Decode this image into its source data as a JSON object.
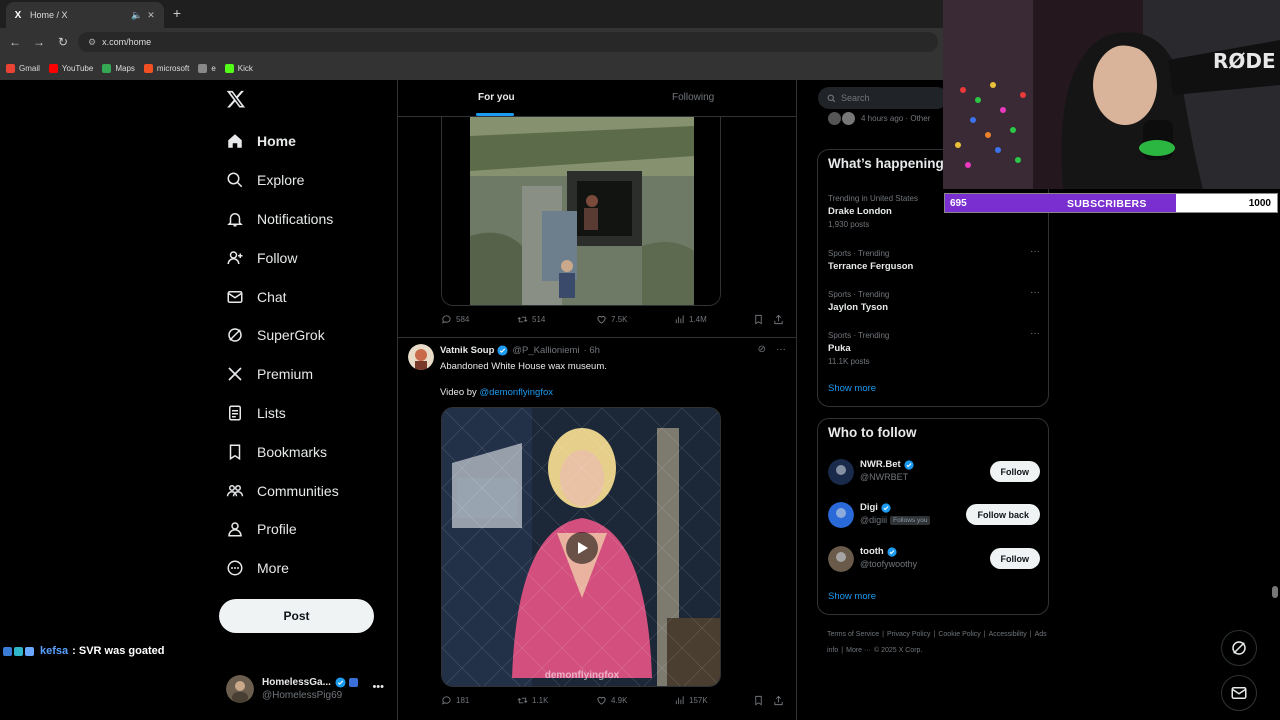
{
  "browser": {
    "tab_title": "Home / X",
    "tab_favicon": "X",
    "url": "x.com/home",
    "bookmarks": [
      {
        "label": "Gmail",
        "color": "#ea4335"
      },
      {
        "label": "YouTube",
        "color": "#ff0000"
      },
      {
        "label": "Maps",
        "color": "#34a853"
      },
      {
        "label": "microsoft",
        "color": "#f25022"
      },
      {
        "label": "e",
        "color": "#888888"
      },
      {
        "label": "Kick",
        "color": "#53fc18"
      }
    ]
  },
  "nav": {
    "items": [
      {
        "label": "Home",
        "icon": "home-icon"
      },
      {
        "label": "Explore",
        "icon": "search-icon"
      },
      {
        "label": "Notifications",
        "icon": "bell-icon"
      },
      {
        "label": "Follow",
        "icon": "person-add-icon"
      },
      {
        "label": "Chat",
        "icon": "mail-icon"
      },
      {
        "label": "SuperGrok",
        "icon": "grok-icon"
      },
      {
        "label": "Premium",
        "icon": "x-icon"
      },
      {
        "label": "Lists",
        "icon": "list-icon"
      },
      {
        "label": "Bookmarks",
        "icon": "bookmark-icon"
      },
      {
        "label": "Communities",
        "icon": "communities-icon"
      },
      {
        "label": "Profile",
        "icon": "profile-icon"
      },
      {
        "label": "More",
        "icon": "more-circle-icon"
      }
    ],
    "post_label": "Post"
  },
  "account": {
    "name": "HomelessGa...",
    "handle": "@HomelessPig69"
  },
  "chat_overlay": {
    "user": "kefsa",
    "message": ": SVR was goated"
  },
  "feed": {
    "tabs": {
      "for_you": "For you",
      "following": "Following"
    },
    "post1_actions": {
      "replies": "584",
      "reposts": "514",
      "likes": "7.5K",
      "views": "1.4M"
    },
    "post2": {
      "name": "Vatnik Soup",
      "handle": "@P_Kallioniemi",
      "time": "· 6h",
      "text": "Abandoned White House wax museum.",
      "via_prefix": "Video by ",
      "via_link": "@demonflyingfox",
      "watermark": "demonflyingfox",
      "actions": {
        "replies": "181",
        "reposts": "1.1K",
        "likes": "4.9K",
        "views": "157K"
      }
    }
  },
  "right": {
    "search_placeholder": "Search",
    "top_partial": "4 hours ago · Other",
    "trending_title": "What’s happening",
    "trends": [
      {
        "category": "Trending in United States",
        "title": "Drake London",
        "count": "1,930 posts"
      },
      {
        "category": "Sports · Trending",
        "title": "Terrance Ferguson",
        "count": ""
      },
      {
        "category": "Sports · Trending",
        "title": "Jaylon Tyson",
        "count": ""
      },
      {
        "category": "Sports · Trending",
        "title": "Puka",
        "count": "11.1K posts"
      }
    ],
    "show_more": "Show more",
    "wtf_title": "Who to follow",
    "who_to_follow": [
      {
        "name": "NWR.Bet",
        "handle": "@NWRBET",
        "button": "Follow",
        "follows_you": ""
      },
      {
        "name": "Digi",
        "handle": "@digiii",
        "button": "Follow back",
        "follows_you": "Follows you"
      },
      {
        "name": "tooth",
        "handle": "@toofywoothy",
        "button": "Follow",
        "follows_you": ""
      }
    ],
    "footer": [
      "Terms of Service",
      "|",
      "Privacy Policy",
      "|",
      "Cookie Policy",
      "|",
      "Accessibility",
      "|",
      "Ads info",
      "|",
      "More ···",
      "© 2025 X Corp."
    ]
  },
  "stream": {
    "sub_current": "695",
    "sub_label": "SUBSCRIBERS",
    "sub_goal": "1000",
    "sub_progress": 0.695,
    "mic_brand": "RØDE"
  },
  "colors": {
    "accent": "#1d9bf0",
    "verified": "#1d9bf0",
    "sub_bar": "#7a2fd0"
  }
}
